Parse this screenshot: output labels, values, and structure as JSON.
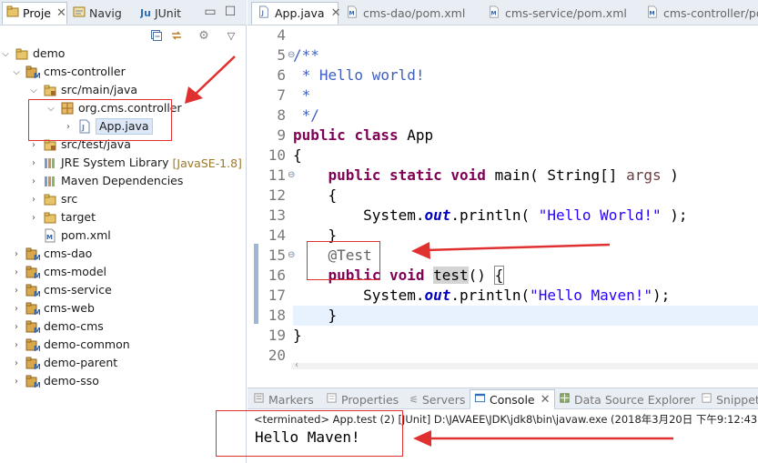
{
  "left_tabs": [
    {
      "label": "Proje",
      "icon": "project-explorer-icon",
      "active": true
    },
    {
      "label": "Navig",
      "icon": "navigator-icon",
      "active": false
    },
    {
      "label": "JUnit",
      "icon": "junit-icon",
      "active": false
    }
  ],
  "tree": [
    {
      "label": "demo",
      "icon": "working-set-icon",
      "expanded": true,
      "depth": 0
    },
    {
      "label": "cms-controller",
      "icon": "maven-project-icon",
      "expanded": true,
      "depth": 1
    },
    {
      "label": "src/main/java",
      "icon": "source-folder-icon",
      "expanded": true,
      "depth": 2
    },
    {
      "label": "org.cms.controller",
      "icon": "package-icon",
      "expanded": true,
      "depth": 3
    },
    {
      "label": "App.java",
      "icon": "java-file-icon",
      "expanded": false,
      "depth": 4,
      "selected": true
    },
    {
      "label": "src/test/java",
      "icon": "source-folder-icon",
      "expanded": false,
      "depth": 2
    },
    {
      "label": "JRE System Library",
      "decoration": "[JavaSE-1.8]",
      "icon": "library-icon",
      "expanded": false,
      "depth": 2
    },
    {
      "label": "Maven Dependencies",
      "icon": "library-icon",
      "expanded": false,
      "depth": 2
    },
    {
      "label": "src",
      "icon": "folder-icon",
      "expanded": false,
      "depth": 2
    },
    {
      "label": "target",
      "icon": "folder-icon",
      "expanded": false,
      "depth": 2
    },
    {
      "label": "pom.xml",
      "icon": "xml-file-icon",
      "expanded": null,
      "depth": 2
    },
    {
      "label": "cms-dao",
      "icon": "maven-project-icon",
      "expanded": false,
      "depth": 1
    },
    {
      "label": "cms-model",
      "icon": "maven-project-icon",
      "expanded": false,
      "depth": 1
    },
    {
      "label": "cms-service",
      "icon": "maven-project-icon",
      "expanded": false,
      "depth": 1
    },
    {
      "label": "cms-web",
      "icon": "maven-project-icon",
      "expanded": false,
      "depth": 1
    },
    {
      "label": "demo-cms",
      "icon": "maven-project-icon",
      "expanded": false,
      "depth": 1
    },
    {
      "label": "demo-common",
      "icon": "maven-project-icon",
      "expanded": false,
      "depth": 1
    },
    {
      "label": "demo-parent",
      "icon": "maven-project-icon",
      "expanded": false,
      "depth": 1
    },
    {
      "label": "demo-sso",
      "icon": "maven-project-icon",
      "expanded": false,
      "depth": 1
    }
  ],
  "editor_tabs": [
    {
      "label": "App.java",
      "icon": "java-file-icon",
      "active": true
    },
    {
      "label": "cms-dao/pom.xml",
      "icon": "xml-file-icon",
      "active": false
    },
    {
      "label": "cms-service/pom.xml",
      "icon": "xml-file-icon",
      "active": false
    },
    {
      "label": "cms-controller/po",
      "icon": "xml-file-icon",
      "active": false
    }
  ],
  "code_lines": [
    {
      "num": "4",
      "text": ""
    },
    {
      "num": "5",
      "text": "/**"
    },
    {
      "num": "6",
      "text": " * Hello world!"
    },
    {
      "num": "7",
      "text": " *"
    },
    {
      "num": "8",
      "text": " */"
    },
    {
      "num": "9",
      "text": "public class App"
    },
    {
      "num": "10",
      "text": "{"
    },
    {
      "num": "11",
      "text": "    public static void main( String[] args )"
    },
    {
      "num": "12",
      "text": "    {"
    },
    {
      "num": "13",
      "text": "        System.out.println( \"Hello World!\" );"
    },
    {
      "num": "14",
      "text": "    }"
    },
    {
      "num": "15",
      "text": "    @Test"
    },
    {
      "num": "16",
      "text": "    public void test() {"
    },
    {
      "num": "17",
      "text": "        System.out.println(\"Hello Maven!\");"
    },
    {
      "num": "18",
      "text": "    }"
    },
    {
      "num": "19",
      "text": "}"
    },
    {
      "num": "20",
      "text": ""
    }
  ],
  "bottom_tabs": [
    {
      "label": "Markers",
      "icon": "markers-icon",
      "active": false
    },
    {
      "label": "Properties",
      "icon": "properties-icon",
      "active": false
    },
    {
      "label": "Servers",
      "icon": "servers-icon",
      "active": false
    },
    {
      "label": "Console",
      "icon": "console-icon",
      "active": true
    },
    {
      "label": "Data Source Explorer",
      "icon": "data-source-icon",
      "active": false
    },
    {
      "label": "Snippet",
      "icon": "snippets-icon",
      "active": false
    }
  ],
  "console": {
    "status": "<terminated> App.test (2) [JUnit] D:\\JAVAEE\\JDK\\jdk8\\bin\\javaw.exe (2018年3月20日 下午9:12:43",
    "output": "Hello Maven!"
  },
  "colors": {
    "annotation_red": "#e03030",
    "keyword": "#7f0055",
    "comment": "#3f5fbf",
    "string": "#2a00ff"
  }
}
